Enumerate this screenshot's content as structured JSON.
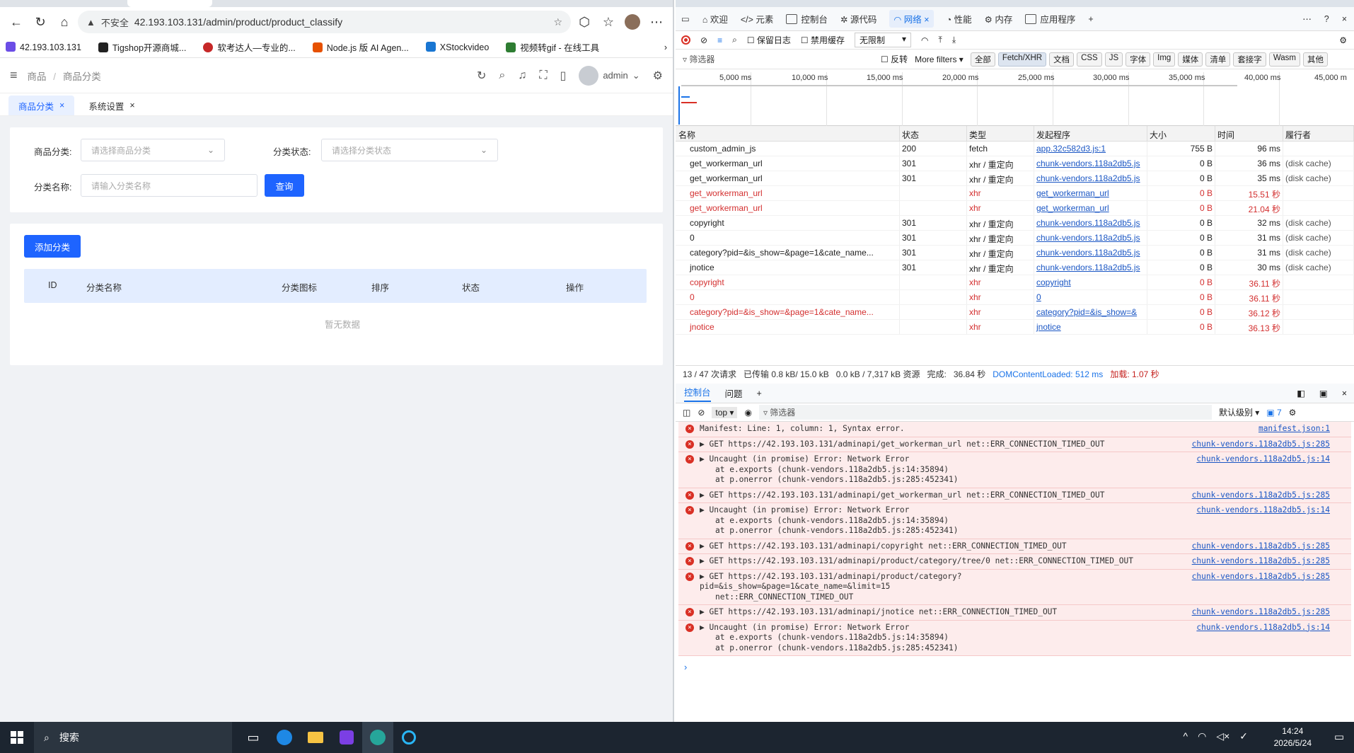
{
  "browser": {
    "url_warning": "不安全",
    "url": "42.193.103.131/admin/product/product_classify",
    "bookmarks": [
      "42.193.103.131",
      "Tigshop开源商城...",
      "软考达人—专业的...",
      "Node.js 版 AI Agen...",
      "XStockvideo",
      "视频转gif - 在线工具"
    ]
  },
  "app": {
    "breadcrumb": [
      "商品",
      "商品分类"
    ],
    "user": "admin",
    "tabs": [
      {
        "label": "商品分类",
        "active": true
      },
      {
        "label": "系统设置",
        "active": false
      }
    ],
    "filter": {
      "category_label": "商品分类:",
      "category_placeholder": "请选择商品分类",
      "status_label": "分类状态:",
      "status_placeholder": "请选择分类状态",
      "name_label": "分类名称:",
      "name_placeholder": "请输入分类名称",
      "query_button": "查询"
    },
    "add_button": "添加分类",
    "columns": [
      "ID",
      "分类名称",
      "分类图标",
      "排序",
      "状态",
      "操作"
    ],
    "empty_text": "暂无数据"
  },
  "devtools": {
    "tabs": [
      "欢迎",
      "元素",
      "控制台",
      "源代码",
      "网络",
      "性能",
      "内存",
      "应用程序"
    ],
    "active_tab": "网络",
    "toolbar": {
      "preserve_log": "保留日志",
      "disable_cache": "禁用缓存",
      "throttle": "无限制"
    },
    "filter": {
      "label": "筛选器",
      "invert": "反转",
      "more_filters": "More filters",
      "chips": [
        "全部",
        "Fetch/XHR",
        "文档",
        "CSS",
        "JS",
        "字体",
        "Img",
        "媒体",
        "清单",
        "套接字",
        "Wasm",
        "其他"
      ]
    },
    "timeline_ticks": [
      "5,000 ms",
      "10,000 ms",
      "15,000 ms",
      "20,000 ms",
      "25,000 ms",
      "30,000 ms",
      "35,000 ms",
      "40,000 ms",
      "45,000 m"
    ],
    "columns": [
      "名称",
      "状态",
      "类型",
      "发起程序",
      "大小",
      "时间",
      "履行者"
    ],
    "requests": [
      {
        "name": "custom_admin_js",
        "status": "200",
        "type": "fetch",
        "initiator": "app.32c582d3.js:1",
        "size": "755 B",
        "time": "96 ms",
        "fulfilled": "",
        "error": false
      },
      {
        "name": "get_workerman_url",
        "status": "301",
        "type": "xhr / 重定向",
        "initiator": "chunk-vendors.118a2db5.js",
        "size": "0 B",
        "time": "36 ms",
        "fulfilled": "(disk cache)",
        "error": false
      },
      {
        "name": "get_workerman_url",
        "status": "301",
        "type": "xhr / 重定向",
        "initiator": "chunk-vendors.118a2db5.js",
        "size": "0 B",
        "time": "35 ms",
        "fulfilled": "(disk cache)",
        "error": false
      },
      {
        "name": "get_workerman_url",
        "status": "",
        "type": "xhr",
        "initiator": "get_workerman_url",
        "size": "0 B",
        "time": "15.51 秒",
        "fulfilled": "",
        "error": true
      },
      {
        "name": "get_workerman_url",
        "status": "",
        "type": "xhr",
        "initiator": "get_workerman_url",
        "size": "0 B",
        "time": "21.04 秒",
        "fulfilled": "",
        "error": true
      },
      {
        "name": "copyright",
        "status": "301",
        "type": "xhr / 重定向",
        "initiator": "chunk-vendors.118a2db5.js",
        "size": "0 B",
        "time": "32 ms",
        "fulfilled": "(disk cache)",
        "error": false
      },
      {
        "name": "0",
        "status": "301",
        "type": "xhr / 重定向",
        "initiator": "chunk-vendors.118a2db5.js",
        "size": "0 B",
        "time": "31 ms",
        "fulfilled": "(disk cache)",
        "error": false
      },
      {
        "name": "category?pid=&is_show=&page=1&cate_name...",
        "status": "301",
        "type": "xhr / 重定向",
        "initiator": "chunk-vendors.118a2db5.js",
        "size": "0 B",
        "time": "31 ms",
        "fulfilled": "(disk cache)",
        "error": false
      },
      {
        "name": "jnotice",
        "status": "301",
        "type": "xhr / 重定向",
        "initiator": "chunk-vendors.118a2db5.js",
        "size": "0 B",
        "time": "30 ms",
        "fulfilled": "(disk cache)",
        "error": false
      },
      {
        "name": "copyright",
        "status": "",
        "type": "xhr",
        "initiator": "copyright",
        "size": "0 B",
        "time": "36.11 秒",
        "fulfilled": "",
        "error": true
      },
      {
        "name": "0",
        "status": "",
        "type": "xhr",
        "initiator": "0",
        "size": "0 B",
        "time": "36.11 秒",
        "fulfilled": "",
        "error": true
      },
      {
        "name": "category?pid=&is_show=&page=1&cate_name...",
        "status": "",
        "type": "xhr",
        "initiator": "category?pid=&is_show=&",
        "size": "0 B",
        "time": "36.12 秒",
        "fulfilled": "",
        "error": true
      },
      {
        "name": "jnotice",
        "status": "",
        "type": "xhr",
        "initiator": "jnotice",
        "size": "0 B",
        "time": "36.13 秒",
        "fulfilled": "",
        "error": true
      }
    ],
    "summary": {
      "requests": "13 /   47 次请求",
      "transferred": "已传输   0.8 kB/   15.0 kB",
      "resources": "0.0 kB /   7,317 kB 资源",
      "finish_label": "完成:",
      "finish": "36.84 秒",
      "dcl": "DOMContentLoaded:   512 ms",
      "load": "加载:   1.07 秒"
    },
    "drawer_tabs": [
      "控制台",
      "问题"
    ],
    "console_toolbar": {
      "context": "top",
      "filter": "筛选器",
      "level": "默认级别",
      "issues": "7"
    },
    "console": [
      {
        "text": "Manifest: Line: 1, column: 1, Syntax error.",
        "src": "manifest.json:1",
        "sub": []
      },
      {
        "text": "▶ GET https://42.193.103.131/adminapi/get_workerman_url net::ERR_CONNECTION_TIMED_OUT",
        "src": "chunk-vendors.118a2db5.js:285",
        "sub": []
      },
      {
        "text": "▶ Uncaught (in promise) Error: Network Error",
        "src": "chunk-vendors.118a2db5.js:14",
        "sub": [
          "at e.exports (chunk-vendors.118a2db5.js:14:35894)",
          "at p.onerror (chunk-vendors.118a2db5.js:285:452341)"
        ]
      },
      {
        "text": "▶ GET https://42.193.103.131/adminapi/get_workerman_url net::ERR_CONNECTION_TIMED_OUT",
        "src": "chunk-vendors.118a2db5.js:285",
        "sub": []
      },
      {
        "text": "▶ Uncaught (in promise) Error: Network Error",
        "src": "chunk-vendors.118a2db5.js:14",
        "sub": [
          "at e.exports (chunk-vendors.118a2db5.js:14:35894)",
          "at p.onerror (chunk-vendors.118a2db5.js:285:452341)"
        ]
      },
      {
        "text": "▶ GET https://42.193.103.131/adminapi/copyright net::ERR_CONNECTION_TIMED_OUT",
        "src": "chunk-vendors.118a2db5.js:285",
        "sub": []
      },
      {
        "text": "▶ GET https://42.193.103.131/adminapi/product/category/tree/0 net::ERR_CONNECTION_TIMED_OUT",
        "src": "chunk-vendors.118a2db5.js:285",
        "sub": []
      },
      {
        "text": "▶ GET https://42.193.103.131/adminapi/product/category?pid=&is_show=&page=1&cate_name=&limit=15",
        "src": "chunk-vendors.118a2db5.js:285",
        "sub": [
          "net::ERR_CONNECTION_TIMED_OUT"
        ]
      },
      {
        "text": "▶ GET https://42.193.103.131/adminapi/jnotice net::ERR_CONNECTION_TIMED_OUT",
        "src": "chunk-vendors.118a2db5.js:285",
        "sub": []
      },
      {
        "text": "▶ Uncaught (in promise) Error: Network Error",
        "src": "chunk-vendors.118a2db5.js:14",
        "sub": [
          "at e.exports (chunk-vendors.118a2db5.js:14:35894)",
          "at p.onerror (chunk-vendors.118a2db5.js:285:452341)"
        ]
      }
    ]
  },
  "taskbar": {
    "search": "搜索",
    "time": "14:24",
    "date": "2026/5/24"
  },
  "colors": {
    "accent": "#1e64ff",
    "devtools_blue": "#1a73e8",
    "error_red": "#d32f2f",
    "console_error_bg": "#fdecec"
  }
}
